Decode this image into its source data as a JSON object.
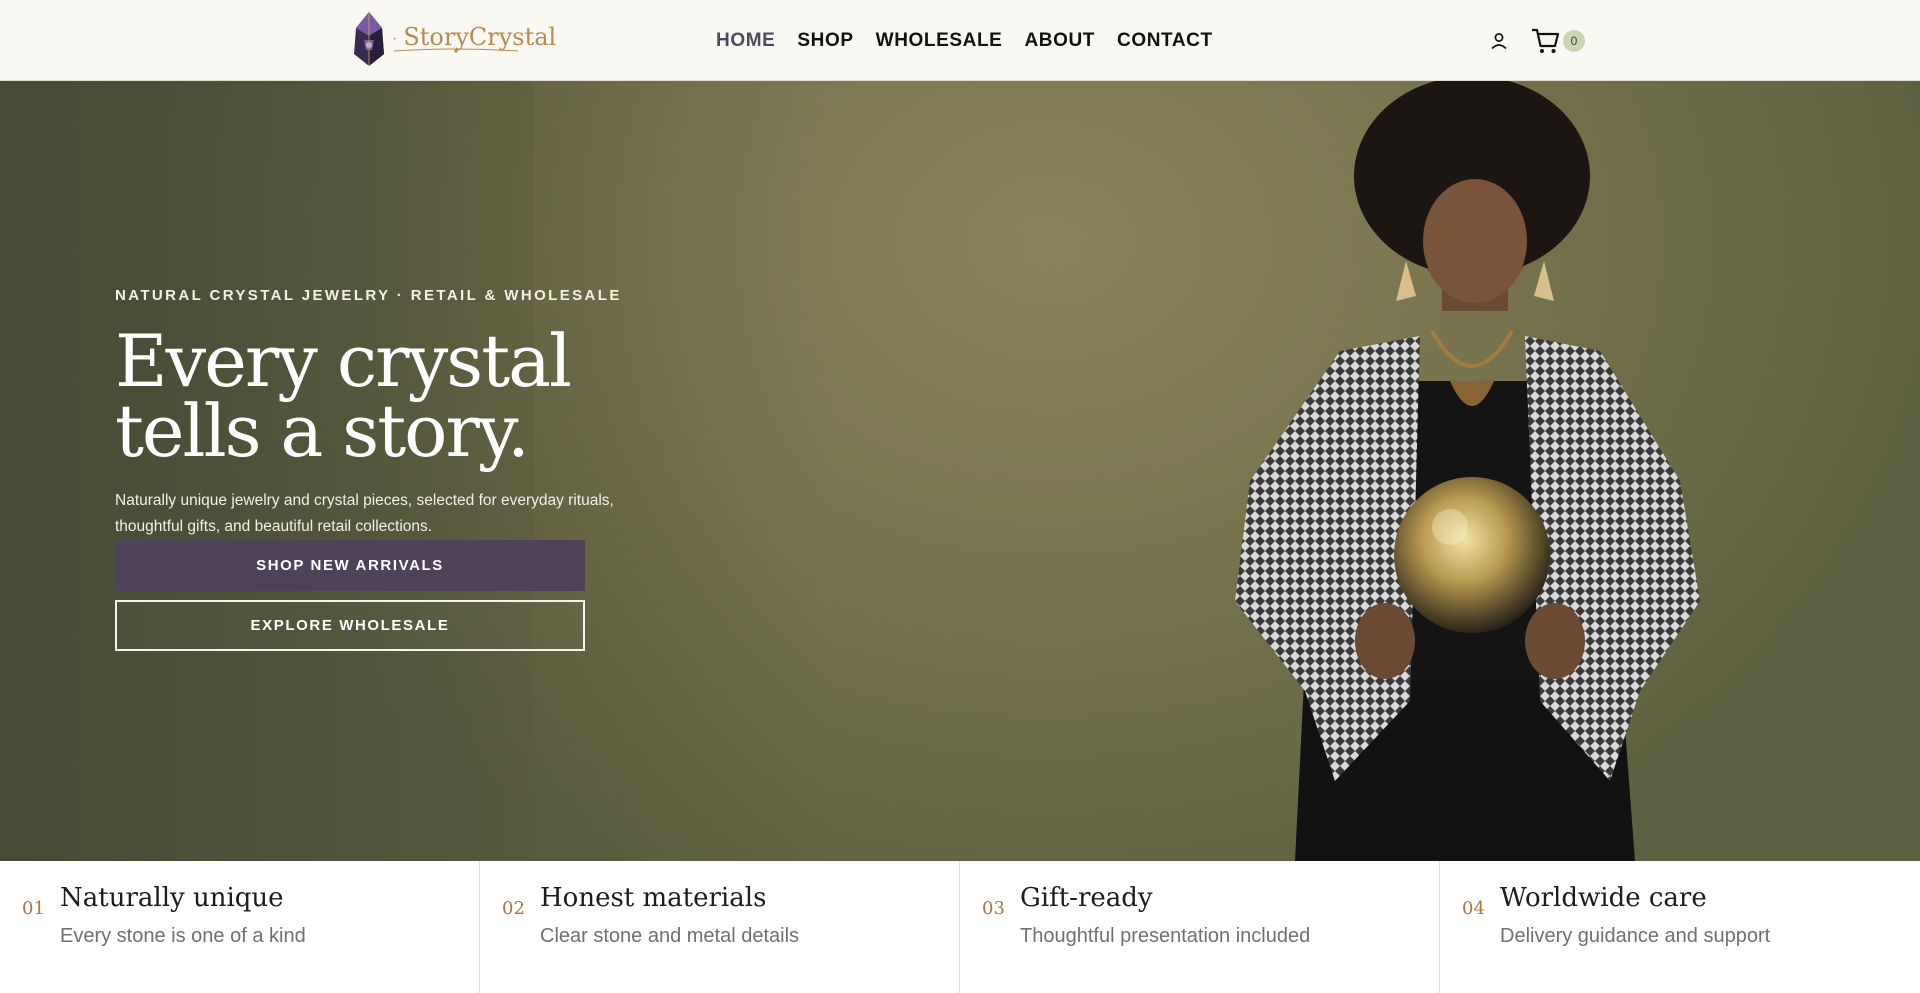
{
  "header": {
    "logo_text": "StoryCrystal",
    "nav": [
      {
        "label": "HOME",
        "active": true
      },
      {
        "label": "SHOP"
      },
      {
        "label": "WHOLESALE"
      },
      {
        "label": "ABOUT"
      },
      {
        "label": "CONTACT"
      }
    ],
    "icons": {
      "account": "user-icon",
      "cart": "cart-icon"
    },
    "cart_count": "0"
  },
  "hero": {
    "eyebrow": "NATURAL CRYSTAL JEWELRY · RETAIL & WHOLESALE",
    "headline_line1": "Every crystal",
    "headline_line2": "tells a story.",
    "subtext": "Naturally unique jewelry and crystal pieces, selected for everyday rituals, thoughtful gifts, and beautiful retail collections.",
    "primary_button": "SHOP NEW ARRIVALS",
    "secondary_button": "EXPLORE WHOLESALE"
  },
  "features": [
    {
      "num": "01",
      "title": "Naturally unique",
      "desc": "Every stone is one of a kind"
    },
    {
      "num": "02",
      "title": "Honest materials",
      "desc": "Clear stone and metal details"
    },
    {
      "num": "03",
      "title": "Gift-ready",
      "desc": "Thoughtful presentation included"
    },
    {
      "num": "04",
      "title": "Worldwide care",
      "desc": "Delivery guidance and support"
    }
  ],
  "colors": {
    "header_bg": "#faf8f3",
    "hero_olive": "#7b7750",
    "primary_button": "#4d4258",
    "brand_gold": "#b88a50",
    "cart_badge": "#c9d6b4"
  }
}
